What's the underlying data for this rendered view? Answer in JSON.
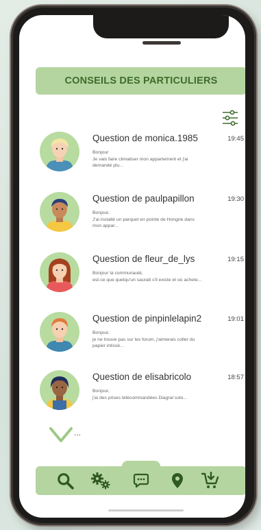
{
  "header": {
    "title": "CONSEILS DES PARTICULIERS"
  },
  "colors": {
    "accent": "#b5d5a0",
    "accent_dark": "#3f6b2d"
  },
  "questions": [
    {
      "title": "Question de monica.1985",
      "time": "19:45",
      "line1": "Bonjour",
      "line2": "Je vais faire climatiser mon appartement et j'ai",
      "line3": "demandé plu..."
    },
    {
      "title": "Question de paulpapillon",
      "time": "19:30",
      "line1": "Bonjour,",
      "line2": "J'ai installé un parquet en pointe de Hongrie dans",
      "line3": "mon appar..."
    },
    {
      "title": "Question de fleur_de_lys",
      "time": "19:15",
      "line1": "Bonjour la communauté,",
      "line2": "est-ce que quelqu'un saurait s'il existe et où achete...",
      "line3": ""
    },
    {
      "title": "Question de pinpinlelapin2",
      "time": "19:01",
      "line1": "Bonjour,",
      "line2": "je ne trouve pas sur les forum, j'aimerais coller du",
      "line3": "papier intissé..."
    },
    {
      "title": "Question de elisabricolo",
      "time": "18:57",
      "line1": "Bonjour,",
      "line2": "j'ai des prises télécommandées Diagral solo...",
      "line3": ""
    }
  ],
  "more": {
    "dots": "..."
  },
  "nav": [
    "search-icon",
    "settings-gears-icon",
    "chat-icon",
    "location-pin-icon",
    "cart-icon"
  ]
}
